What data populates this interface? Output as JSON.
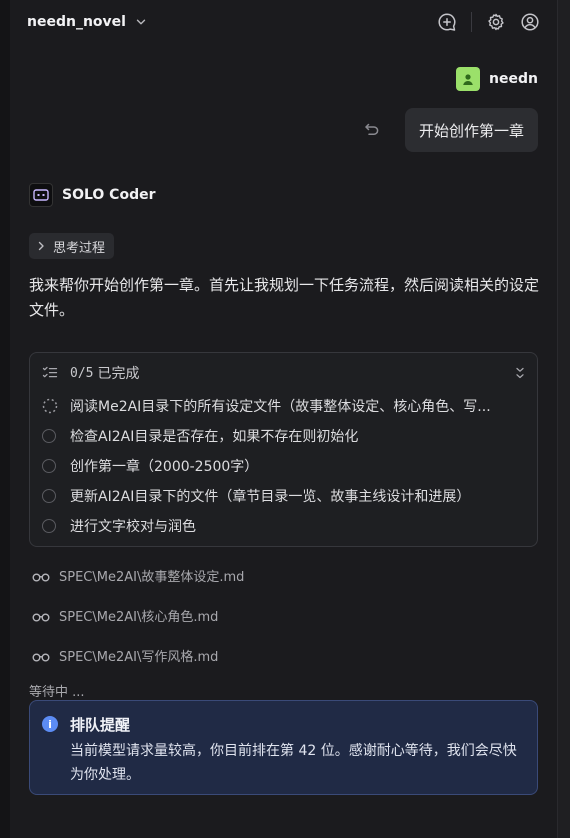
{
  "header": {
    "project_name": "needn_novel",
    "icons": [
      "chat-add-icon",
      "gear-icon",
      "user-circle-icon"
    ]
  },
  "user": {
    "name": "needn",
    "message": "开始创作第一章",
    "avatar_color": "#9be06a"
  },
  "agent": {
    "name": "SOLO Coder",
    "thinking_label": "思考过程",
    "reply": "我来帮你开始创作第一章。首先让我规划一下任务流程，然后阅读相关的设定文件。"
  },
  "tasks": {
    "progress": "0/5",
    "progress_label": "已完成",
    "items": [
      {
        "label": "阅读Me2AI目录下的所有设定文件（故事整体设定、核心角色、写...",
        "status": "in-progress"
      },
      {
        "label": "检查AI2AI目录是否存在，如果不存在则初始化",
        "status": "pending"
      },
      {
        "label": "创作第一章（2000-2500字）",
        "status": "pending"
      },
      {
        "label": "更新AI2AI目录下的文件（章节目录一览、故事主线设计和进展）",
        "status": "pending"
      },
      {
        "label": "进行文字校对与润色",
        "status": "pending"
      }
    ]
  },
  "files": [
    "SPEC\\Me2AI\\故事整体设定.md",
    "SPEC\\Me2AI\\核心角色.md",
    "SPEC\\Me2AI\\写作风格.md"
  ],
  "status": {
    "waiting": "等待中 ..."
  },
  "notice": {
    "title": "排队提醒",
    "body": "当前模型请求量较高，你目前排在第 42 位。感谢耐心等待，我们会尽快为你处理。",
    "accent_color": "#5c8cf4"
  }
}
